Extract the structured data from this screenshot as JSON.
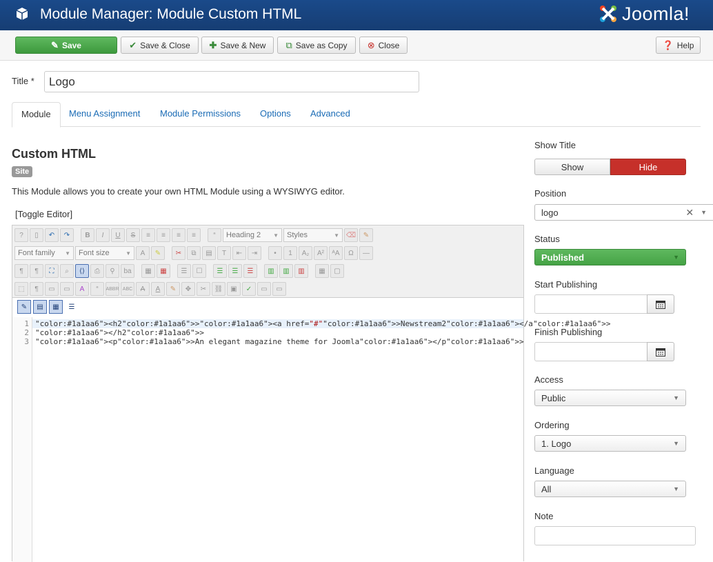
{
  "header": {
    "title": "Module Manager: Module Custom HTML",
    "logo_text": "Joomla!"
  },
  "toolbar": {
    "save": "Save",
    "save_close": "Save & Close",
    "save_new": "Save & New",
    "save_copy": "Save as Copy",
    "close": "Close",
    "help": "Help"
  },
  "title_field": {
    "label": "Title *",
    "value": "Logo"
  },
  "tabs": [
    {
      "label": "Module"
    },
    {
      "label": "Menu Assignment"
    },
    {
      "label": "Module Permissions"
    },
    {
      "label": "Options"
    },
    {
      "label": "Advanced"
    }
  ],
  "module": {
    "heading": "Custom HTML",
    "badge": "Site",
    "description": "This Module allows you to create your own HTML Module using a WYSIWYG editor.",
    "toggle_editor": "[Toggle Editor]"
  },
  "editor": {
    "format_select": "Heading 2",
    "styles_select": "Styles",
    "font_family": "Font family",
    "font_size": "Font size",
    "lines": [
      {
        "num": "1",
        "text": "<h2><a href=\"#\">Newstream2</a>"
      },
      {
        "num": "2",
        "text": "</h2>"
      },
      {
        "num": "3",
        "text": "<p>An elegant magazine theme for Joomla</p>"
      }
    ]
  },
  "sidebar": {
    "show_title": {
      "label": "Show Title",
      "show": "Show",
      "hide": "Hide"
    },
    "position": {
      "label": "Position",
      "value": "logo"
    },
    "status": {
      "label": "Status",
      "value": "Published"
    },
    "start_publishing": {
      "label": "Start Publishing",
      "value": ""
    },
    "finish_publishing": {
      "label": "Finish Publishing",
      "value": ""
    },
    "access": {
      "label": "Access",
      "value": "Public"
    },
    "ordering": {
      "label": "Ordering",
      "value": "1. Logo"
    },
    "language": {
      "label": "Language",
      "value": "All"
    },
    "note": {
      "label": "Note",
      "value": ""
    }
  },
  "colors": {
    "header_bg": "#1a4a8a",
    "save_green": "#46a546",
    "hide_red": "#c6302a",
    "link_blue": "#1a6bb5"
  }
}
